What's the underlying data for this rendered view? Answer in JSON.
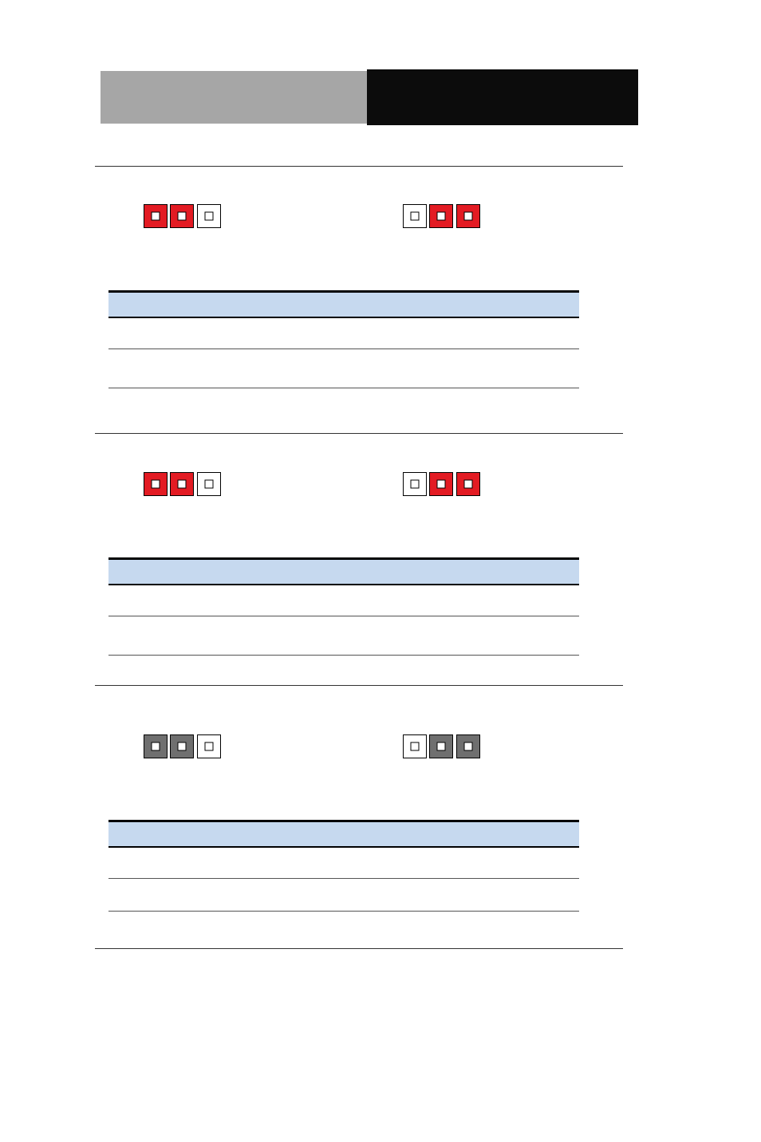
{
  "header": {
    "left_bg": "#a6a6a6",
    "right_bg": "#0c0c0c"
  },
  "sections": [
    {
      "chip_color": "red",
      "left_pattern": [
        "fill",
        "fill",
        "blank"
      ],
      "right_pattern": [
        "blank",
        "fill",
        "fill"
      ]
    },
    {
      "chip_color": "red",
      "left_pattern": [
        "fill",
        "fill",
        "blank"
      ],
      "right_pattern": [
        "blank",
        "fill",
        "fill"
      ]
    },
    {
      "chip_color": "gray",
      "left_pattern": [
        "fill",
        "fill",
        "blank"
      ],
      "right_pattern": [
        "blank",
        "fill",
        "fill"
      ]
    }
  ]
}
